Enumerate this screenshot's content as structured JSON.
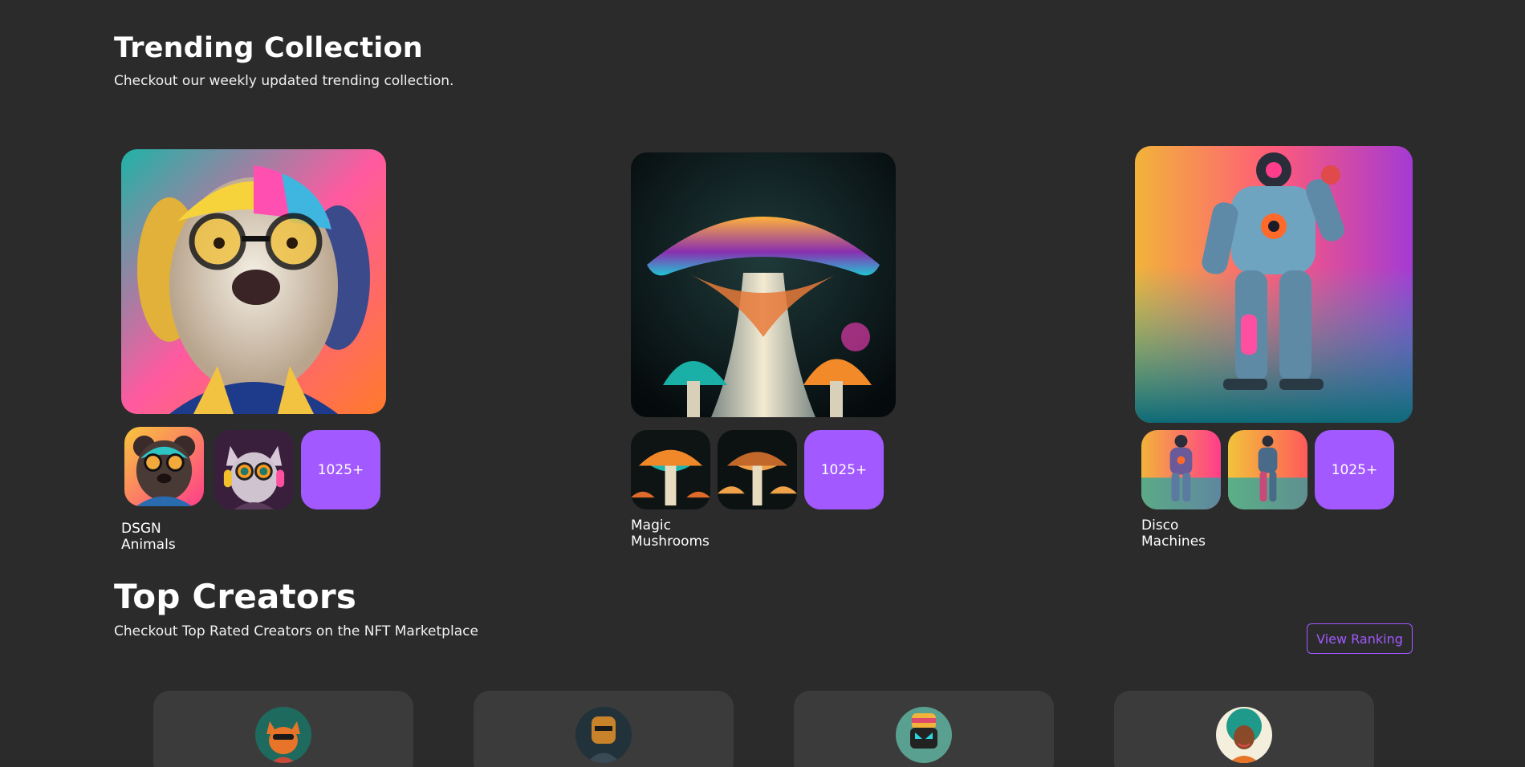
{
  "trending": {
    "title": "Trending Collection",
    "subtitle": "Checkout our weekly updated trending collection.",
    "collections": [
      {
        "name": "DSGN Animals",
        "count": "1025+",
        "image": "colorful-dog-with-glasses"
      },
      {
        "name": "Magic Mushrooms",
        "count": "1025+",
        "image": "glowing-mushrooms"
      },
      {
        "name": "Disco Machines",
        "count": "1025+",
        "image": "neon-robot-astronaut"
      }
    ]
  },
  "creators": {
    "title": "Top Creators",
    "subtitle": "Checkout Top Rated Creators on the NFT Marketplace",
    "view_ranking_label": "View Ranking",
    "avatars": [
      "fox-avatar",
      "robot-avatar",
      "visor-avatar",
      "afro-woman-avatar"
    ]
  },
  "colors": {
    "background": "#2b2b2b",
    "accent": "#a259ff",
    "card": "#3b3b3b"
  }
}
